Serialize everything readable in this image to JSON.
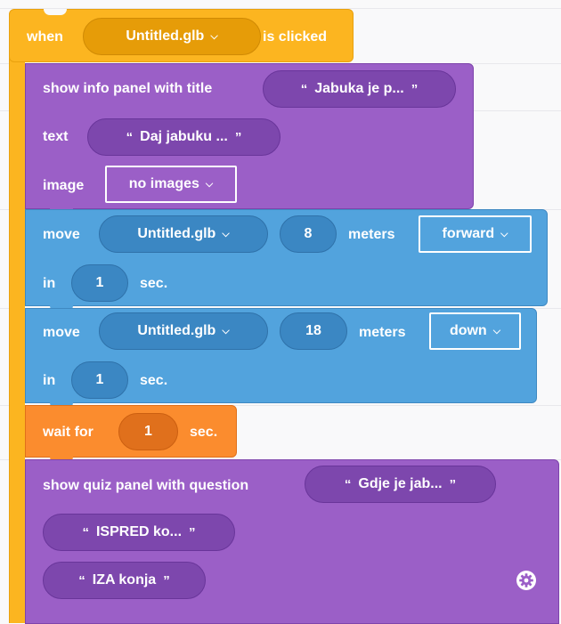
{
  "event_block": {
    "when_label": "when",
    "model_dropdown": "Untitled.glb",
    "clicked_label": "is clicked"
  },
  "info_panel": {
    "header_label": "show info panel with title",
    "title_value": "Jabuka je p...",
    "text_label": "text",
    "text_value": "Daj jabuku ...",
    "image_label": "image",
    "image_dropdown": "no images"
  },
  "move_block_1": {
    "move_label": "move",
    "object_dropdown": "Untitled.glb",
    "distance_value": "8",
    "meters_label": "meters",
    "direction_dropdown": "forward",
    "in_label": "in",
    "duration_value": "1",
    "sec_label": "sec."
  },
  "move_block_2": {
    "move_label": "move",
    "object_dropdown": "Untitled.glb",
    "distance_value": "18",
    "meters_label": "meters",
    "direction_dropdown": "down",
    "in_label": "in",
    "duration_value": "1",
    "sec_label": "sec."
  },
  "wait_block": {
    "wait_label": "wait for",
    "duration_value": "1",
    "sec_label": "sec."
  },
  "quiz_panel": {
    "header_label": "show quiz panel with question",
    "question_value": "Gdje je jab...",
    "answers": [
      "ISPRED ko...",
      "IZA konja"
    ]
  },
  "quote_open": "“",
  "quote_close": "”",
  "chevron_icon": "chevron-down-icon",
  "settings_icon": "gear-icon"
}
